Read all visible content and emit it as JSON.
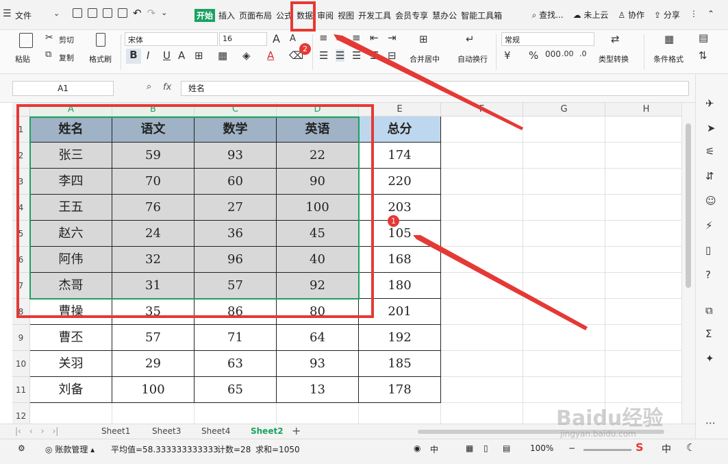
{
  "menu": {
    "file": "文件",
    "tabs": [
      "开始",
      "插入",
      "页面布局",
      "公式",
      "数据",
      "审阅",
      "视图",
      "开发工具",
      "会员专享",
      "慧办公",
      "智能工具箱"
    ],
    "search": "查找...",
    "cloud": "未上云",
    "cooperate": "协作",
    "share": "分享"
  },
  "ribbon": {
    "paste": "粘贴",
    "cut": "剪切",
    "copy": "复制",
    "format_painter": "格式刷",
    "font_name": "宋体",
    "font_size": "16",
    "merge_center": "合并居中",
    "auto_wrap": "自动换行",
    "number_format": "常规",
    "type_convert": "类型转换",
    "cond_format": "条件格式"
  },
  "formula": {
    "name_box": "A1",
    "fx": "fx",
    "content": "姓名"
  },
  "columns": [
    "A",
    "B",
    "C",
    "D",
    "E",
    "F",
    "G",
    "H"
  ],
  "row_numbers": [
    "1",
    "2",
    "3",
    "4",
    "5",
    "6",
    "7",
    "8",
    "9",
    "10",
    "11",
    "12"
  ],
  "table": {
    "headers": [
      "姓名",
      "语文",
      "数学",
      "英语",
      "总分"
    ],
    "rows": [
      [
        "张三",
        "59",
        "93",
        "22",
        "174"
      ],
      [
        "李四",
        "70",
        "60",
        "90",
        "220"
      ],
      [
        "王五",
        "76",
        "27",
        "100",
        "203"
      ],
      [
        "赵六",
        "24",
        "36",
        "45",
        "105"
      ],
      [
        "阿伟",
        "32",
        "96",
        "40",
        "168"
      ],
      [
        "杰哥",
        "31",
        "57",
        "92",
        "180"
      ],
      [
        "曹操",
        "35",
        "86",
        "80",
        "201"
      ],
      [
        "曹丕",
        "57",
        "71",
        "64",
        "192"
      ],
      [
        "关羽",
        "29",
        "63",
        "93",
        "185"
      ],
      [
        "刘备",
        "100",
        "65",
        "13",
        "178"
      ]
    ]
  },
  "badges": {
    "one": "1",
    "two": "2"
  },
  "sheets": [
    "Sheet1",
    "Sheet3",
    "Sheet4",
    "Sheet2"
  ],
  "active_sheet": "Sheet2",
  "status": {
    "account": "账款管理",
    "average": "平均值=58.333333333333",
    "count": "计数=28",
    "sum": "求和=1050",
    "zoom": "100%"
  },
  "watermark": {
    "main": "Baidu经验",
    "sub": "jingyan.baidu.com"
  },
  "colors": {
    "accent": "#1aa260",
    "header_fill": "#bdd7ee",
    "selection_fill": "#d8d8d8",
    "annotation": "#e53935"
  }
}
